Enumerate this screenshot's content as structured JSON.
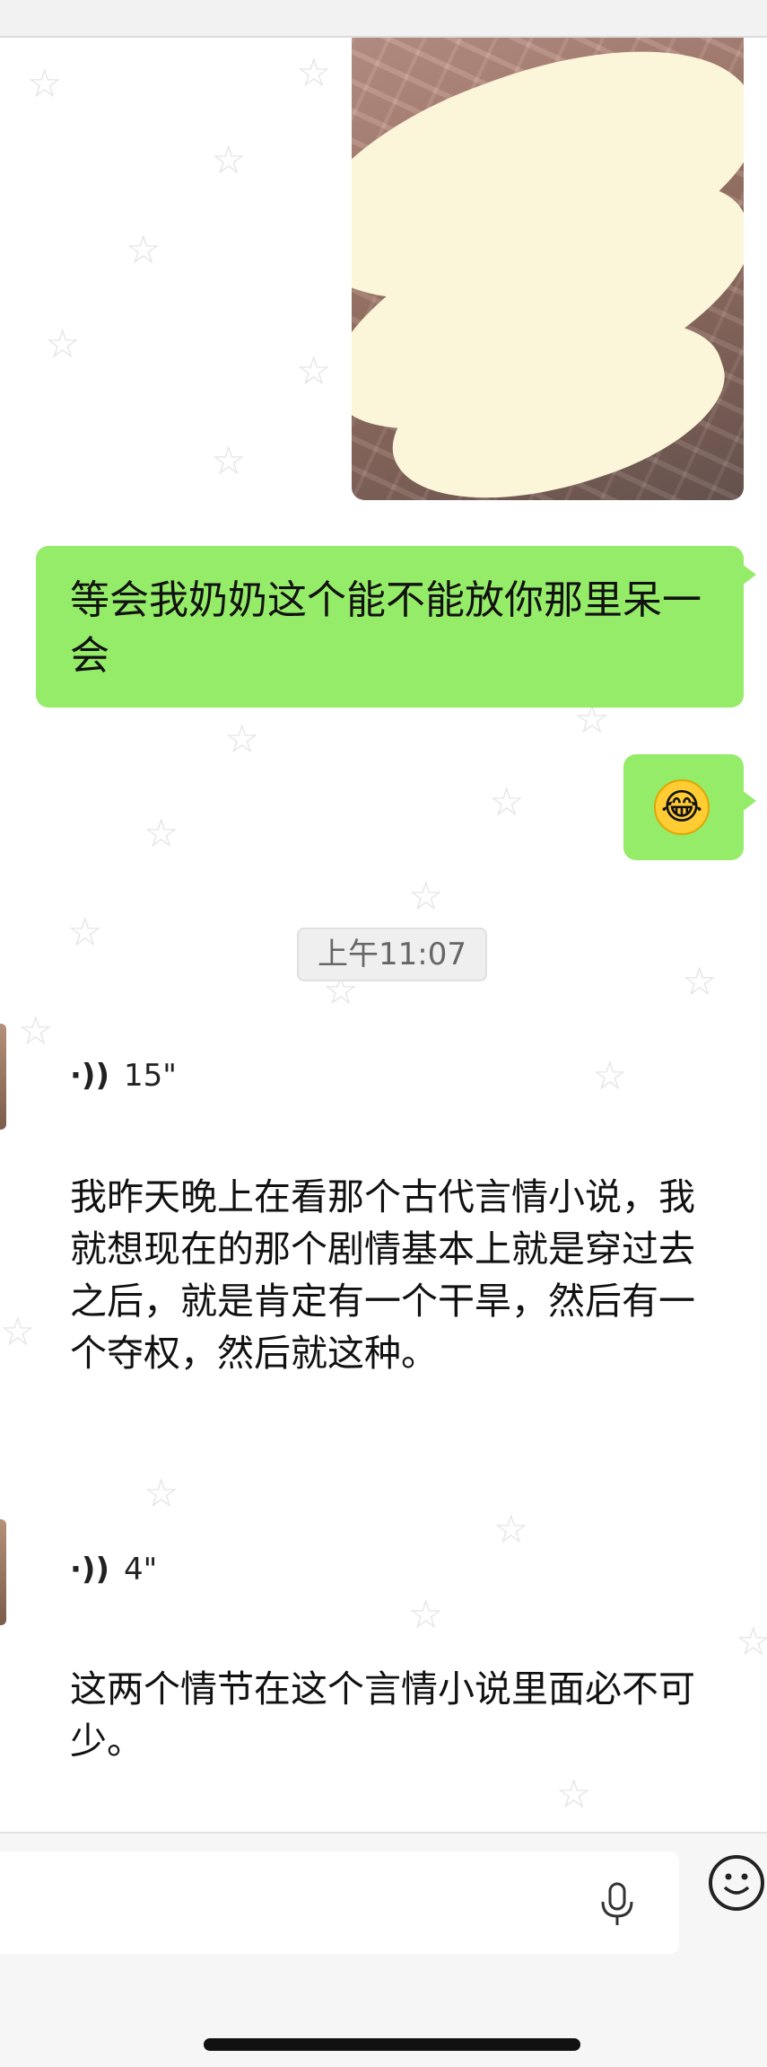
{
  "messages": {
    "sent_text": "等会我奶奶这个能不能放你那里呆一会",
    "sent_emoji": "😂",
    "timestamp": "上午11:07",
    "voice_1": {
      "duration": "15\"",
      "transcript": "我昨天晚上在看那个古代言情小说，我就想现在的那个剧情基本上就是穿过去之后，就是肯定有一个干旱，然后有一个夺权，然后就这种。"
    },
    "voice_2": {
      "duration": "4\"",
      "transcript": "这两个情节在这个言情小说里面必不可少。"
    }
  },
  "icons": {
    "voice_wave": "voice-wave-icon",
    "microphone": "microphone-icon",
    "emoji": "emoji-icon"
  },
  "colors": {
    "sent_bubble": "#95ec69",
    "chat_background": "#ffffff",
    "input_bar": "#f6f6f6"
  }
}
